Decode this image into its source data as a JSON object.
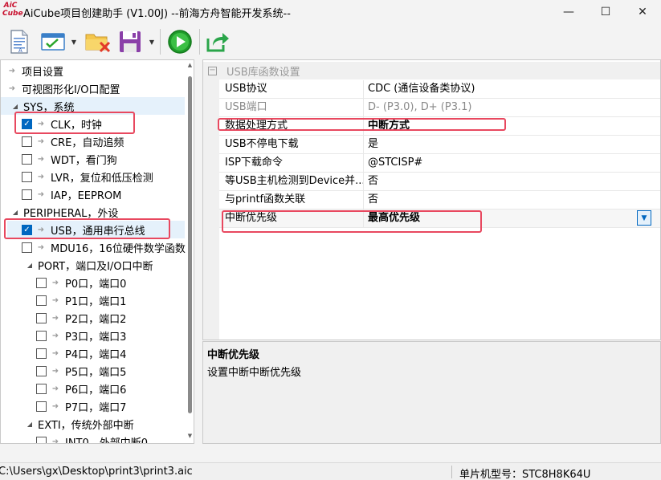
{
  "window": {
    "logo_text_top": "AiC",
    "logo_text_bottom": "Cube",
    "title": "AiCube项目创建助手 (V1.00J) --前海方舟智能开发系统--",
    "minimize": "—",
    "maximize": "☐",
    "close": "✕"
  },
  "toolbar": {
    "icons": [
      "new-document-icon",
      "configure-icon",
      "close-folder-icon",
      "save-icon",
      "run-icon",
      "export-icon"
    ]
  },
  "tree": {
    "items": [
      {
        "label": "项目设置",
        "type": "leaf"
      },
      {
        "label": "可视图形化I/O口配置",
        "type": "leaf"
      },
      {
        "label": "SYS，系统",
        "type": "group"
      },
      {
        "label": "CLK，时钟",
        "checked": true
      },
      {
        "label": "CRE，自动追频",
        "checked": false
      },
      {
        "label": "WDT，看门狗",
        "checked": false
      },
      {
        "label": "LVR，复位和低压检测",
        "checked": false
      },
      {
        "label": "IAP，EEPROM",
        "checked": false
      },
      {
        "label": "PERIPHERAL，外设",
        "type": "group"
      },
      {
        "label": "USB，通用串行总线",
        "checked": true
      },
      {
        "label": "MDU16，16位硬件数学函数",
        "checked": false
      },
      {
        "label": "PORT，端口及I/O口中断",
        "type": "group"
      },
      {
        "label": "P0口，端口0",
        "checked": false
      },
      {
        "label": "P1口，端口1",
        "checked": false
      },
      {
        "label": "P2口，端口2",
        "checked": false
      },
      {
        "label": "P3口，端口3",
        "checked": false
      },
      {
        "label": "P4口，端口4",
        "checked": false
      },
      {
        "label": "P5口，端口5",
        "checked": false
      },
      {
        "label": "P6口，端口6",
        "checked": false
      },
      {
        "label": "P7口，端口7",
        "checked": false
      },
      {
        "label": "EXTI，传统外部中断",
        "type": "group"
      },
      {
        "label": "INT0，外部中断0",
        "checked": false
      }
    ]
  },
  "property_grid": {
    "category": "USB库函数设置",
    "rows": [
      {
        "name": "USB协议",
        "value": "CDC (通信设备类协议)"
      },
      {
        "name": "USB端口",
        "value": "D- (P3.0), D+ (P3.1)"
      },
      {
        "name": "数据处理方式",
        "value": "中断方式"
      },
      {
        "name": "USB不停电下载",
        "value": "是"
      },
      {
        "name": "ISP下载命令",
        "value": "@STCISP#"
      },
      {
        "name": "等USB主机检测到Device并...",
        "value": "否"
      },
      {
        "name": "与printf函数关联",
        "value": "否"
      },
      {
        "name": "中断优先级",
        "value": "最高优先级"
      }
    ]
  },
  "help": {
    "title": "中断优先级",
    "description": "设置中断中断优先级"
  },
  "status": {
    "path": "C:\\Users\\gx\\Desktop\\print3\\print3.aic",
    "chip": "单片机型号：STC8H8K64U"
  },
  "colors": {
    "accent": "#0067c0",
    "highlight": "#e8485f"
  }
}
